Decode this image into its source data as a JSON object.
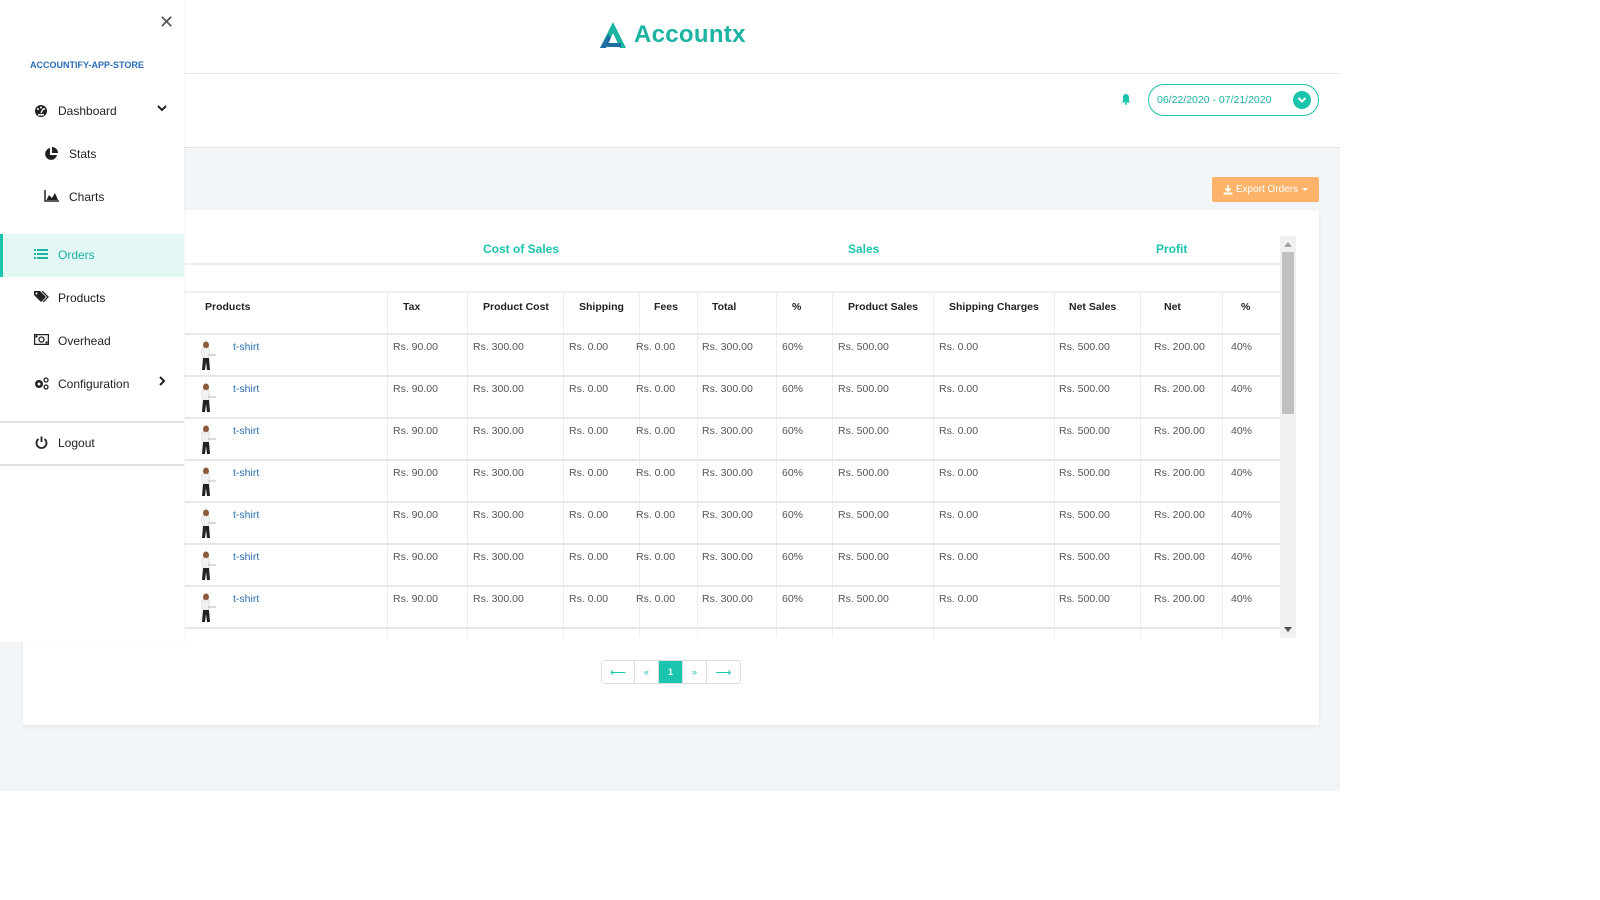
{
  "header": {
    "logo_text": "Accountx",
    "date_range": "06/22/2020 - 07/21/2020"
  },
  "actions": {
    "export_label": "Export Orders"
  },
  "sidebar": {
    "store_name": "ACCOUNTIFY-APP-STORE",
    "items": [
      {
        "label": "Dashboard",
        "icon": "dashboard-icon"
      },
      {
        "label": "Stats",
        "icon": "pie-chart-icon"
      },
      {
        "label": "Charts",
        "icon": "area-chart-icon"
      },
      {
        "label": "Orders",
        "icon": "list-icon"
      },
      {
        "label": "Products",
        "icon": "tags-icon"
      },
      {
        "label": "Overhead",
        "icon": "money-bill-icon"
      },
      {
        "label": "Configuration",
        "icon": "cogs-icon"
      },
      {
        "label": "Logout",
        "icon": "power-icon"
      }
    ]
  },
  "table": {
    "groups": [
      "Cost of Sales",
      "Sales",
      "Profit"
    ],
    "columns": [
      "Products",
      "Tax",
      "Product Cost",
      "Shipping",
      "Fees",
      "Total",
      "%",
      "Product Sales",
      "Shipping Charges",
      "Net Sales",
      "Net",
      "%"
    ],
    "rows": [
      [
        "t-shirt",
        "Rs. 90.00",
        "Rs. 300.00",
        "Rs. 0.00",
        "Rs. 0.00",
        "Rs. 300.00",
        "60%",
        "Rs. 500.00",
        "Rs. 0.00",
        "Rs. 500.00",
        "Rs. 200.00",
        "40%"
      ],
      [
        "t-shirt",
        "Rs. 90.00",
        "Rs. 300.00",
        "Rs. 0.00",
        "Rs. 0.00",
        "Rs. 300.00",
        "60%",
        "Rs. 500.00",
        "Rs. 0.00",
        "Rs. 500.00",
        "Rs. 200.00",
        "40%"
      ],
      [
        "t-shirt",
        "Rs. 90.00",
        "Rs. 300.00",
        "Rs. 0.00",
        "Rs. 0.00",
        "Rs. 300.00",
        "60%",
        "Rs. 500.00",
        "Rs. 0.00",
        "Rs. 500.00",
        "Rs. 200.00",
        "40%"
      ],
      [
        "t-shirt",
        "Rs. 90.00",
        "Rs. 300.00",
        "Rs. 0.00",
        "Rs. 0.00",
        "Rs. 300.00",
        "60%",
        "Rs. 500.00",
        "Rs. 0.00",
        "Rs. 500.00",
        "Rs. 200.00",
        "40%"
      ],
      [
        "t-shirt",
        "Rs. 90.00",
        "Rs. 300.00",
        "Rs. 0.00",
        "Rs. 0.00",
        "Rs. 300.00",
        "60%",
        "Rs. 500.00",
        "Rs. 0.00",
        "Rs. 500.00",
        "Rs. 200.00",
        "40%"
      ],
      [
        "t-shirt",
        "Rs. 90.00",
        "Rs. 300.00",
        "Rs. 0.00",
        "Rs. 0.00",
        "Rs. 300.00",
        "60%",
        "Rs. 500.00",
        "Rs. 0.00",
        "Rs. 500.00",
        "Rs. 200.00",
        "40%"
      ],
      [
        "t-shirt",
        "Rs. 90.00",
        "Rs. 300.00",
        "Rs. 0.00",
        "Rs. 0.00",
        "Rs. 300.00",
        "60%",
        "Rs. 500.00",
        "Rs. 0.00",
        "Rs. 500.00",
        "Rs. 200.00",
        "40%"
      ]
    ]
  },
  "pagination": {
    "first": "⟵",
    "prev": "«",
    "current": "1",
    "next": "»",
    "last": "⟶"
  },
  "colors": {
    "accent": "#1bc4ad",
    "export": "#fdb46a",
    "link": "#2a6db5"
  }
}
